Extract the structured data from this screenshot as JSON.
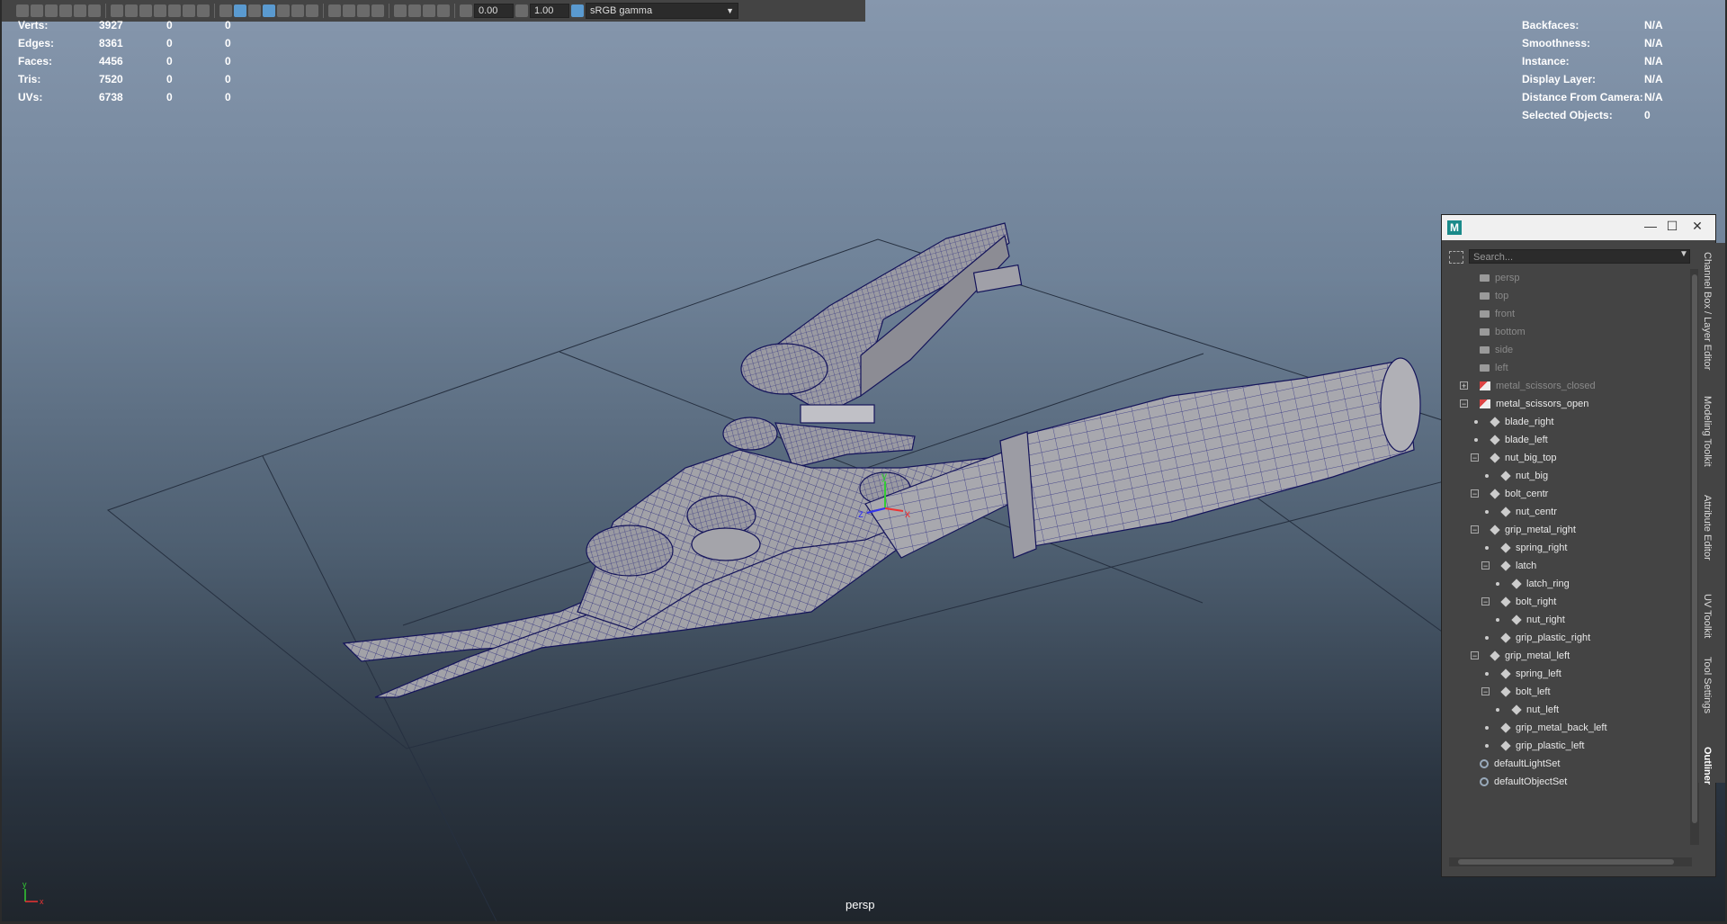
{
  "toolbar": {
    "exposure": "0.00",
    "gamma": "1.00",
    "color_space": "sRGB gamma"
  },
  "hud_left": [
    {
      "label": "Verts:",
      "v1": "3927",
      "v2": "0",
      "v3": "0"
    },
    {
      "label": "Edges:",
      "v1": "8361",
      "v2": "0",
      "v3": "0"
    },
    {
      "label": "Faces:",
      "v1": "4456",
      "v2": "0",
      "v3": "0"
    },
    {
      "label": "Tris:",
      "v1": "7520",
      "v2": "0",
      "v3": "0"
    },
    {
      "label": "UVs:",
      "v1": "6738",
      "v2": "0",
      "v3": "0"
    }
  ],
  "hud_right": [
    {
      "label": "Backfaces:",
      "value": "N/A"
    },
    {
      "label": "Smoothness:",
      "value": "N/A"
    },
    {
      "label": "Instance:",
      "value": "N/A"
    },
    {
      "label": "Display Layer:",
      "value": "N/A"
    },
    {
      "label": "Distance From Camera:",
      "value": "N/A"
    },
    {
      "label": "Selected Objects:",
      "value": "0"
    }
  ],
  "viewport_label": "persp",
  "gizmo": {
    "y": "y",
    "z": "z",
    "x": "x"
  },
  "outliner": {
    "logo": "M",
    "search_placeholder": "Search...",
    "items": [
      {
        "label": "persp",
        "icon": "camera-icon",
        "dim": true,
        "indent": 0
      },
      {
        "label": "top",
        "icon": "camera-icon",
        "dim": true,
        "indent": 0
      },
      {
        "label": "front",
        "icon": "camera-icon",
        "dim": true,
        "indent": 0
      },
      {
        "label": "bottom",
        "icon": "camera-icon",
        "dim": true,
        "indent": 0
      },
      {
        "label": "side",
        "icon": "camera-icon",
        "dim": true,
        "indent": 0
      },
      {
        "label": "left",
        "icon": "camera-icon",
        "dim": true,
        "indent": 0
      },
      {
        "label": "metal_scissors_closed",
        "icon": "group-icon",
        "dim": true,
        "indent": 0,
        "expander": "+"
      },
      {
        "label": "metal_scissors_open",
        "icon": "group-icon",
        "dim": false,
        "indent": 0,
        "expander": "−"
      },
      {
        "label": "blade_right",
        "icon": "mesh-icon",
        "dim": false,
        "indent": 1
      },
      {
        "label": "blade_left",
        "icon": "mesh-icon",
        "dim": false,
        "indent": 1
      },
      {
        "label": "nut_big_top",
        "icon": "mesh-icon",
        "dim": false,
        "indent": 1,
        "expander": "−"
      },
      {
        "label": "nut_big",
        "icon": "mesh-icon",
        "dim": false,
        "indent": 2
      },
      {
        "label": "bolt_centr",
        "icon": "mesh-icon",
        "dim": false,
        "indent": 1,
        "expander": "−"
      },
      {
        "label": "nut_centr",
        "icon": "mesh-icon",
        "dim": false,
        "indent": 2
      },
      {
        "label": "grip_metal_right",
        "icon": "mesh-icon",
        "dim": false,
        "indent": 1,
        "expander": "−"
      },
      {
        "label": "spring_right",
        "icon": "mesh-icon",
        "dim": false,
        "indent": 2
      },
      {
        "label": "latch",
        "icon": "mesh-icon",
        "dim": false,
        "indent": 2,
        "expander": "−"
      },
      {
        "label": "latch_ring",
        "icon": "mesh-icon",
        "dim": false,
        "indent": 3
      },
      {
        "label": "bolt_right",
        "icon": "mesh-icon",
        "dim": false,
        "indent": 2,
        "expander": "−"
      },
      {
        "label": "nut_right",
        "icon": "mesh-icon",
        "dim": false,
        "indent": 3
      },
      {
        "label": "grip_plastic_right",
        "icon": "mesh-icon",
        "dim": false,
        "indent": 2
      },
      {
        "label": "grip_metal_left",
        "icon": "mesh-icon",
        "dim": false,
        "indent": 1,
        "expander": "−"
      },
      {
        "label": "spring_left",
        "icon": "mesh-icon",
        "dim": false,
        "indent": 2
      },
      {
        "label": "bolt_left",
        "icon": "mesh-icon",
        "dim": false,
        "indent": 2,
        "expander": "−"
      },
      {
        "label": "nut_left",
        "icon": "mesh-icon",
        "dim": false,
        "indent": 3
      },
      {
        "label": "grip_metal_back_left",
        "icon": "mesh-icon",
        "dim": false,
        "indent": 2
      },
      {
        "label": "grip_plastic_left",
        "icon": "mesh-icon",
        "dim": false,
        "indent": 2
      },
      {
        "label": "defaultLightSet",
        "icon": "set-icon",
        "dim": false,
        "indent": 0
      },
      {
        "label": "defaultObjectSet",
        "icon": "set-icon",
        "dim": false,
        "indent": 0
      }
    ]
  },
  "side_tabs": [
    {
      "label": "Channel Box / Layer Editor",
      "active": false
    },
    {
      "label": "Modeling Toolkit",
      "active": false
    },
    {
      "label": "Attribute Editor",
      "active": false
    },
    {
      "label": "UV Toolkit",
      "active": false
    },
    {
      "label": "Tool Settings",
      "active": false
    },
    {
      "label": "Outliner",
      "active": true
    }
  ],
  "colors": {
    "wire": "#1a1a7a",
    "mesh": "#9a9aa0",
    "grid": "#2a2f3a"
  }
}
